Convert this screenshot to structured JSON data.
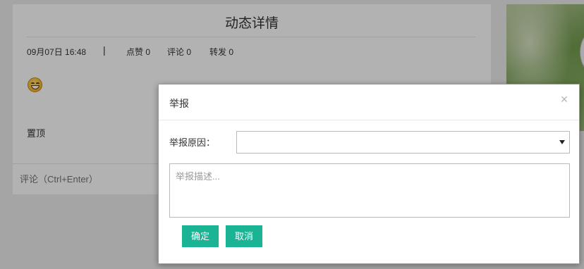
{
  "detail": {
    "title": "动态详情",
    "date": "09月07日 16:48",
    "separator": "|",
    "likes": "点赞 0",
    "comments": "评论 0",
    "shares": "转发 0",
    "emoji_icon": "smiley-emoji-icon",
    "pin_label": "置顶",
    "comment_placeholder": "评论（Ctrl+Enter）"
  },
  "report_dialog": {
    "title": "举报",
    "close_icon": "close-icon",
    "close_glyph": "×",
    "reason_label": "举报原因：",
    "reason_value": "",
    "description_placeholder": "举报描述...",
    "confirm_label": "确定",
    "cancel_label": "取消"
  },
  "colors": {
    "primary_button": "#1ab394",
    "overlay": "rgba(0,0,0,0.30)"
  }
}
